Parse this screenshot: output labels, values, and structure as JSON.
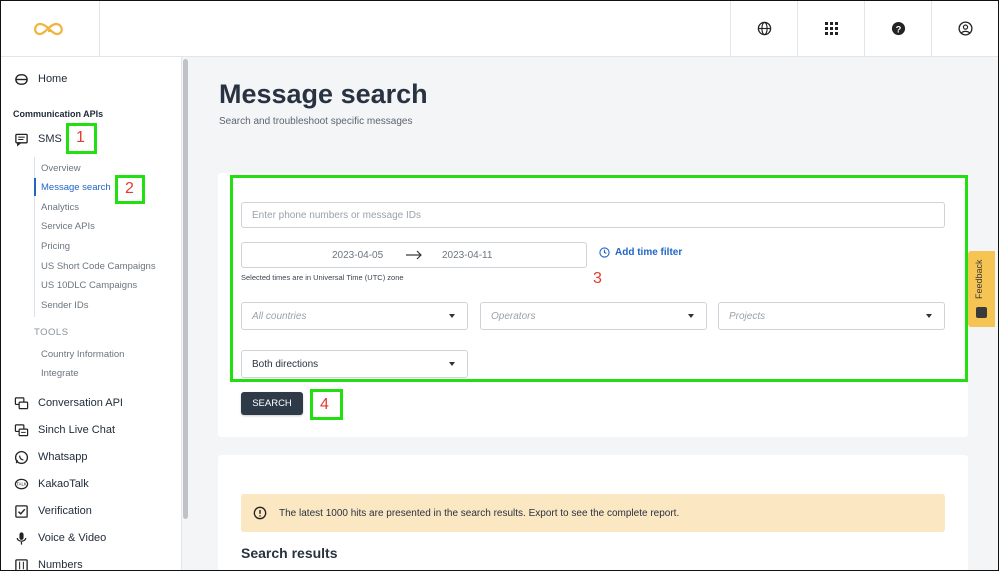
{
  "topbar": {
    "logo_icon": "infinity-logo-icon",
    "icons": [
      "globe-icon",
      "apps-grid-icon",
      "help-icon",
      "user-icon"
    ]
  },
  "sidebar": {
    "home": "Home",
    "section_communication": "Communication APIs",
    "sms": "SMS",
    "sms_subitems": [
      "Overview",
      "Message search",
      "Analytics",
      "Service APIs",
      "Pricing",
      "US Short Code Campaigns",
      "US 10DLC Campaigns",
      "Sender IDs"
    ],
    "tools_heading": "TOOLS",
    "tools_items": [
      "Country Information",
      "Integrate"
    ],
    "items": [
      "Conversation API",
      "Sinch Live Chat",
      "Whatsapp",
      "KakaoTalk",
      "Verification",
      "Voice & Video",
      "Numbers"
    ]
  },
  "main": {
    "title": "Message search",
    "subtitle": "Search and troubleshoot specific messages",
    "search_placeholder": "Enter phone numbers or message IDs",
    "date_from": "2023-04-05",
    "date_to": "2023-04-11",
    "add_time_filter": "Add time filter",
    "utc_note": "Selected times are in Universal Time (UTC) zone",
    "countries_placeholder": "All countries",
    "operators_placeholder": "Operators",
    "projects_placeholder": "Projects",
    "directions_value": "Both directions",
    "search_button": "SEARCH",
    "notice": "The latest 1000 hits are presented in the search results. Export to see the complete report.",
    "results_title": "Search results",
    "feedback": "Feedback"
  },
  "annotations": {
    "n1": "1",
    "n2": "2",
    "n3": "3",
    "n4": "4"
  },
  "colors": {
    "accent": "#2166c6",
    "logo": "#f0b541",
    "highlight": "#22e010",
    "annotation_number": "#e33b2e"
  }
}
